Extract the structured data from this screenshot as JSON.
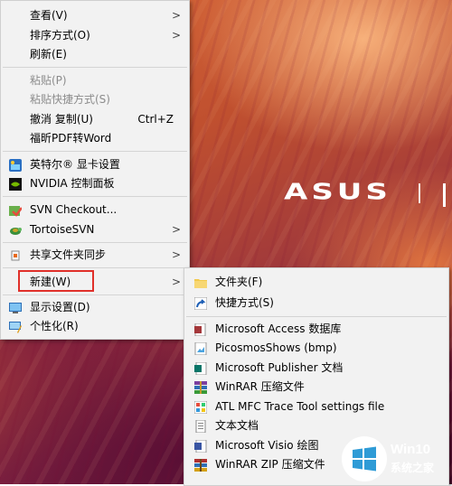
{
  "desktop": {
    "brand_logo": "ASUS"
  },
  "main_menu": {
    "items": [
      {
        "label": "查看(V)"
      },
      {
        "label": "排序方式(O)"
      },
      {
        "label": "刷新(E)"
      },
      {
        "label": "粘贴(P)"
      },
      {
        "label": "粘贴快捷方式(S)"
      },
      {
        "label": "撤消 复制(U)",
        "shortcut": "Ctrl+Z"
      },
      {
        "label": "福昕PDF转Word"
      },
      {
        "label": "英特尔® 显卡设置"
      },
      {
        "label": "NVIDIA 控制面板"
      },
      {
        "label": "SVN Checkout..."
      },
      {
        "label": "TortoiseSVN"
      },
      {
        "label": "共享文件夹同步"
      },
      {
        "label": "新建(W)"
      },
      {
        "label": "显示设置(D)"
      },
      {
        "label": "个性化(R)"
      }
    ]
  },
  "submenu": {
    "items": [
      {
        "label": "文件夹(F)"
      },
      {
        "label": "快捷方式(S)"
      },
      {
        "label": "Microsoft Access 数据库"
      },
      {
        "label": "PicosmosShows (bmp)"
      },
      {
        "label": "Microsoft Publisher 文档"
      },
      {
        "label": "WinRAR 压缩文件"
      },
      {
        "label": "ATL MFC Trace Tool settings file"
      },
      {
        "label": "文本文档"
      },
      {
        "label": "Microsoft Visio 绘图"
      },
      {
        "label": "WinRAR ZIP 压缩文件"
      }
    ]
  },
  "watermark": {
    "line1": "Win10",
    "line2": "系统之家"
  },
  "colors": {
    "menu_bg": "#f2f2f2",
    "highlight_border": "#e0302a",
    "disabled_text": "#8c8c8c"
  }
}
